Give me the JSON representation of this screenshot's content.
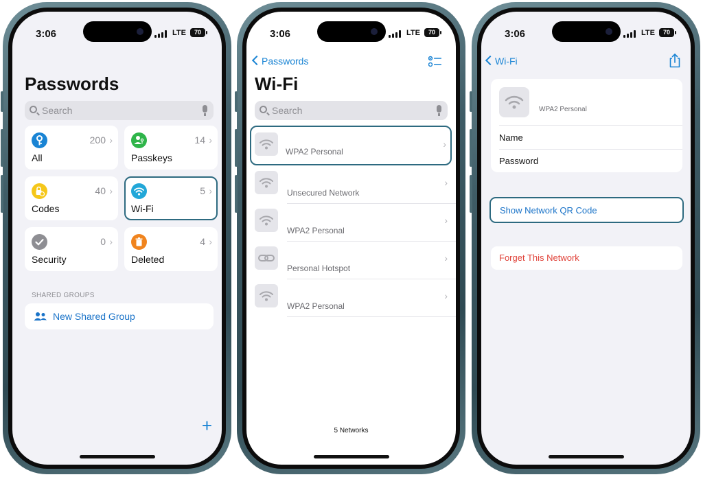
{
  "status_bar": {
    "time": "3:06",
    "network": "LTE",
    "battery": "70"
  },
  "passwords_screen": {
    "title": "Passwords",
    "search_placeholder": "Search",
    "categories": [
      {
        "label": "All",
        "count": "200",
        "icon": "key-icon",
        "color": "#1a84d4"
      },
      {
        "label": "Passkeys",
        "count": "14",
        "icon": "passkey-person-icon",
        "color": "#2fb54a"
      },
      {
        "label": "Codes",
        "count": "40",
        "icon": "lock-clock-icon",
        "color": "#f5c71a"
      },
      {
        "label": "Wi-Fi",
        "count": "5",
        "icon": "wifi-icon",
        "color": "#22a7d8"
      },
      {
        "label": "Security",
        "count": "0",
        "icon": "checkmark-icon",
        "color": "#8e8e93"
      },
      {
        "label": "Deleted",
        "count": "4",
        "icon": "trash-icon",
        "color": "#f0841e"
      }
    ],
    "shared_groups_header": "SHARED GROUPS",
    "new_shared_group": "New Shared Group",
    "add_symbol": "+"
  },
  "wifi_screen": {
    "back_label": "Passwords",
    "title": "Wi-Fi",
    "search_placeholder": "Search",
    "networks": [
      {
        "security": "WPA2 Personal",
        "icon": "wifi-icon"
      },
      {
        "security": "Unsecured Network",
        "icon": "wifi-icon"
      },
      {
        "security": "WPA2 Personal",
        "icon": "wifi-icon"
      },
      {
        "security": "Personal Hotspot",
        "icon": "link-icon"
      },
      {
        "security": "WPA2 Personal",
        "icon": "wifi-icon"
      }
    ],
    "footer": "5 Networks"
  },
  "network_detail_screen": {
    "back_label": "Wi-Fi",
    "security": "WPA2 Personal",
    "name_label": "Name",
    "password_label": "Password",
    "show_qr": "Show Network QR Code",
    "forget": "Forget This Network"
  },
  "colors": {
    "accent": "#1a84d4",
    "highlight_border": "#2d6a80",
    "destructive": "#e0433a",
    "grouped_background": "#f2f2f7"
  }
}
